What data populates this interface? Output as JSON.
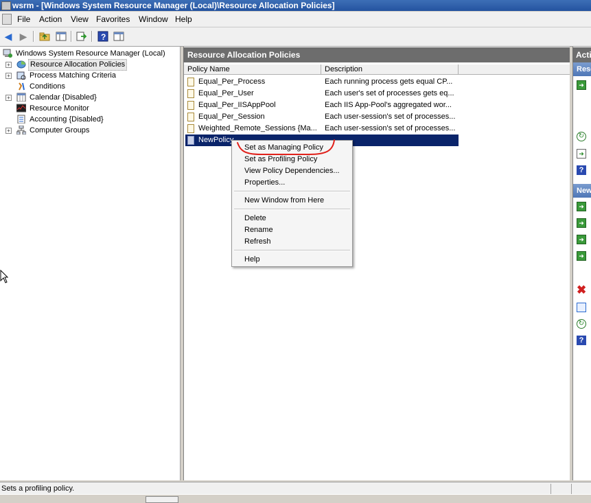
{
  "window": {
    "title": "wsrm - [Windows System Resource Manager (Local)\\Resource Allocation Policies]"
  },
  "menu": {
    "items": [
      "File",
      "Action",
      "View",
      "Favorites",
      "Window",
      "Help"
    ]
  },
  "tree": {
    "root": "Windows System Resource Manager (Local)",
    "items": [
      {
        "label": "Resource Allocation Policies",
        "expandable": true,
        "selected": true
      },
      {
        "label": "Process Matching Criteria",
        "expandable": true
      },
      {
        "label": "Conditions",
        "expandable": false
      },
      {
        "label": "Calendar  {Disabled}",
        "expandable": true
      },
      {
        "label": "Resource Monitor",
        "expandable": false
      },
      {
        "label": "Accounting  {Disabled}",
        "expandable": false
      },
      {
        "label": "Computer Groups",
        "expandable": true
      }
    ]
  },
  "main": {
    "header": "Resource Allocation Policies",
    "columns": [
      "Policy Name",
      "Description"
    ],
    "rows": [
      {
        "name": "Equal_Per_Process",
        "description": "Each running process gets equal CP..."
      },
      {
        "name": "Equal_Per_User",
        "description": "Each user's set of processes gets eq..."
      },
      {
        "name": "Equal_Per_IISAppPool",
        "description": "Each IIS App-Pool's aggregated wor..."
      },
      {
        "name": "Equal_Per_Session",
        "description": "Each user-session's set of processes..."
      },
      {
        "name": "Weighted_Remote_Sessions  {Ma...",
        "description": "Each user-session's set of processes..."
      },
      {
        "name": "NewPolicy",
        "description": "",
        "selected": true
      }
    ]
  },
  "actions": {
    "header": "Actio",
    "group1": "Reso",
    "group2": "New"
  },
  "context_menu": {
    "items": [
      "Set as Managing Policy",
      "Set as Profiling Policy",
      "View Policy Dependencies...",
      "Properties...",
      "New Window from Here",
      "Delete",
      "Rename",
      "Refresh",
      "Help"
    ]
  },
  "status": {
    "text": "Sets a profiling policy."
  },
  "colors": {
    "selection": "#0a246a",
    "annotation": "#e0201a",
    "pane_header": "#6d6d6d"
  }
}
